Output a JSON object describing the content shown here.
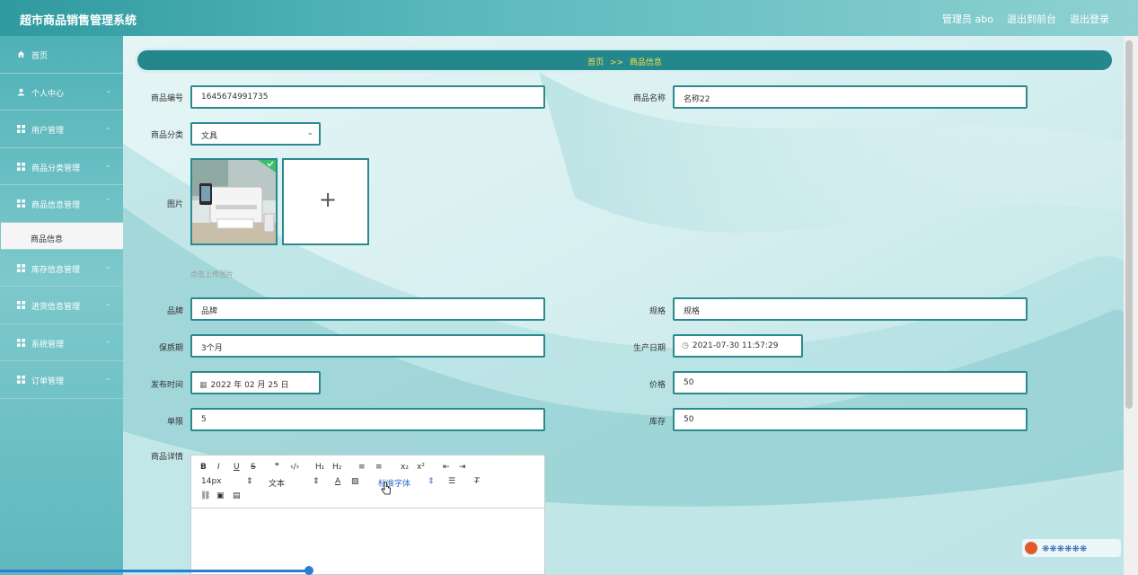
{
  "header": {
    "app_title": "超市商品销售管理系统",
    "user_label": "管理员 abo",
    "back_to_front": "退出到前台",
    "logout": "退出登录"
  },
  "sidebar": {
    "items": [
      {
        "label": "首页",
        "icon": "home-icon",
        "has_chevron": false
      },
      {
        "label": "个人中心",
        "icon": "user-icon",
        "has_chevron": true
      },
      {
        "label": "用户管理",
        "icon": "grid-icon",
        "has_chevron": true
      },
      {
        "label": "商品分类管理",
        "icon": "grid-icon",
        "has_chevron": true
      },
      {
        "label": "商品信息管理",
        "icon": "grid-icon",
        "has_chevron": true
      }
    ],
    "sub_item": "商品信息",
    "items_after": [
      {
        "label": "库存信息管理",
        "icon": "grid-icon"
      },
      {
        "label": "进货信息管理",
        "icon": "grid-icon"
      },
      {
        "label": "系统管理",
        "icon": "grid-icon"
      },
      {
        "label": "订单管理",
        "icon": "grid-icon"
      }
    ]
  },
  "breadcrumb": {
    "home": "首页",
    "separator": ">>",
    "current": "商品信息"
  },
  "form": {
    "product_no_label": "商品编号",
    "product_no_value": "1645674991735",
    "product_name_label": "商品名称",
    "product_name_value": "名称22",
    "category_label": "商品分类",
    "category_value": "文具",
    "image_label": "图片",
    "upload_hint": "点击上传图片",
    "brand_label": "品牌",
    "brand_value": "品牌",
    "spec_label": "规格",
    "spec_value": "规格",
    "shelf_life_label": "保质期",
    "shelf_life_value": "3个月",
    "production_date_label": "生产日期",
    "production_date_value": "2021-07-30 11:57:29",
    "publish_time_label": "发布时间",
    "publish_time_value": "2022 年 02 月 25 日",
    "price_label": "价格",
    "price_value": "50",
    "limit_label": "单限",
    "limit_value": "5",
    "stock_label": "库存",
    "stock_value": "50",
    "detail_label": "商品详情"
  },
  "editor": {
    "font_size": "14px",
    "text_style": "文本",
    "font_family": "标准字体",
    "buttons": [
      "B",
      "I",
      "U",
      "S",
      "❞",
      "‹/›",
      "H₁",
      "H₂",
      "≡",
      "≡",
      "x₂",
      "x²",
      "⇤",
      "⇥"
    ]
  },
  "colors": {
    "accent": "#23878b",
    "breadcrumb_text": "#f5e04a",
    "input_border": "#2a8a8e"
  }
}
